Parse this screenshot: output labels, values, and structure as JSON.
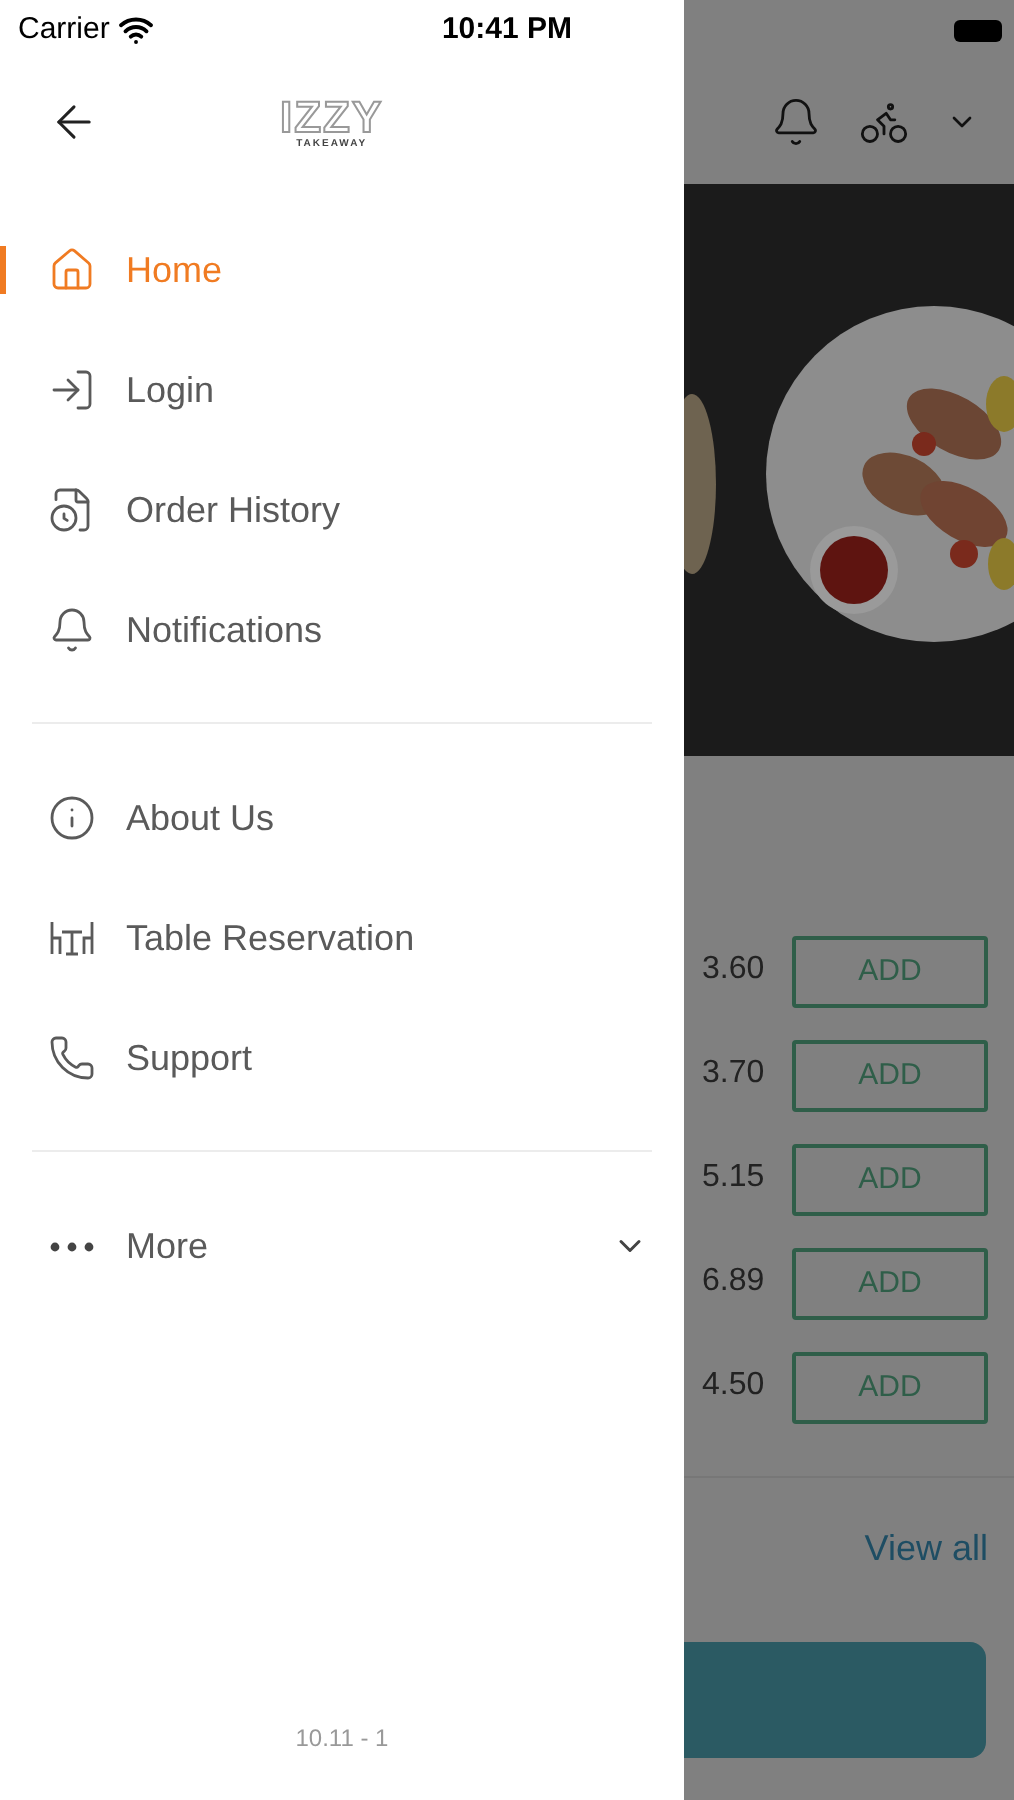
{
  "status_bar": {
    "carrier": "Carrier",
    "time": "10:41 PM"
  },
  "drawer": {
    "logo": {
      "name": "IZZY",
      "tagline": "TAKEAWAY"
    },
    "sections": [
      {
        "items": [
          {
            "label": "Home",
            "kind": "home",
            "selected": true
          },
          {
            "label": "Login",
            "kind": "login",
            "selected": false
          },
          {
            "label": "Order History",
            "kind": "history",
            "selected": false
          },
          {
            "label": "Notifications",
            "kind": "bell",
            "selected": false
          }
        ]
      },
      {
        "items": [
          {
            "label": "About Us",
            "kind": "info",
            "selected": false
          },
          {
            "label": "Table Reservation",
            "kind": "table",
            "selected": false
          },
          {
            "label": "Support",
            "kind": "phone",
            "selected": false
          }
        ]
      }
    ],
    "more": {
      "label": "More",
      "expanded": false
    },
    "version": "10.11 - 1"
  },
  "background": {
    "items": [
      {
        "price": "3.60",
        "button": "ADD"
      },
      {
        "price": "3.70",
        "button": "ADD"
      },
      {
        "price": "5.15",
        "button": "ADD"
      },
      {
        "price": "6.89",
        "button": "ADD"
      },
      {
        "price": "4.50",
        "button": "ADD"
      }
    ],
    "view_all": "View all"
  }
}
